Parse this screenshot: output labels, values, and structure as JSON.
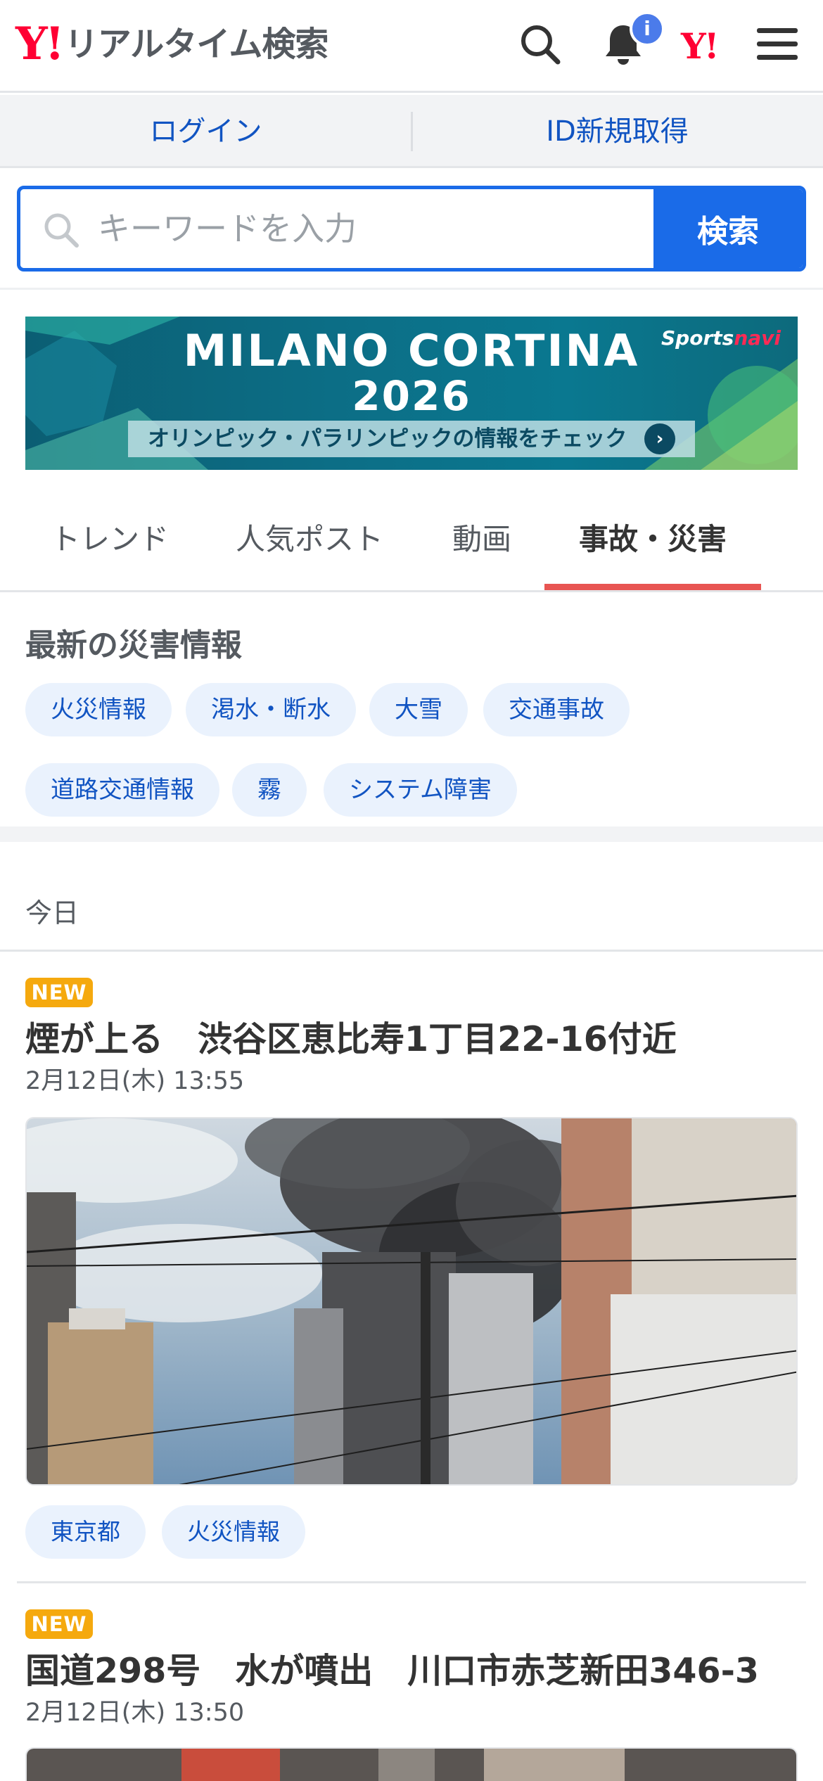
{
  "header": {
    "logo_y": "Y!",
    "logo_text": "リアルタイム検索",
    "notification_badge": "i",
    "yj_icon": "Y!",
    "icons": [
      "search-icon",
      "bell-icon",
      "yahoo-japan-icon",
      "hamburger-menu-icon"
    ]
  },
  "account": {
    "login_label": "ログイン",
    "signup_label": "ID新規取得"
  },
  "search": {
    "placeholder": "キーワードを入力",
    "value": "",
    "button_label": "検索"
  },
  "banner": {
    "title": "MILANO CORTINA",
    "year": "2026",
    "tagline": "オリンピック・パラリンピックの情報をチェック",
    "brand_main": "Sports",
    "brand_accent": "navi",
    "brand_accent_color": "#ff2a55"
  },
  "tabs": [
    {
      "label": "トレンド",
      "active": false
    },
    {
      "label": "人気ポスト",
      "active": false
    },
    {
      "label": "動画",
      "active": false
    },
    {
      "label": "事故・災害",
      "active": true
    }
  ],
  "disaster": {
    "title": "最新の災害情報",
    "chips": [
      "火災情報",
      "渇水・断水",
      "大雪",
      "交通事故",
      "道路交通情報",
      "霧",
      "システム障害"
    ]
  },
  "today_label": "今日",
  "articles": [
    {
      "badge": "NEW",
      "title": "煙が上る　渋谷区恵比寿1丁目22-16付近",
      "time": "2月12日(木) 13:55",
      "tags": [
        "東京都",
        "火災情報"
      ]
    },
    {
      "badge": "NEW",
      "title": "国道298号　水が噴出　川口市赤芝新田346-3",
      "time": "2月12日(木) 13:50",
      "tags": []
    }
  ],
  "colors": {
    "accent_blue": "#1a6be8",
    "link_blue": "#1154c2",
    "yahoo_red": "#ff0033",
    "tab_underline": "#e85552",
    "new_badge": "#f5a90e",
    "chip_bg": "#eaf2fd"
  }
}
